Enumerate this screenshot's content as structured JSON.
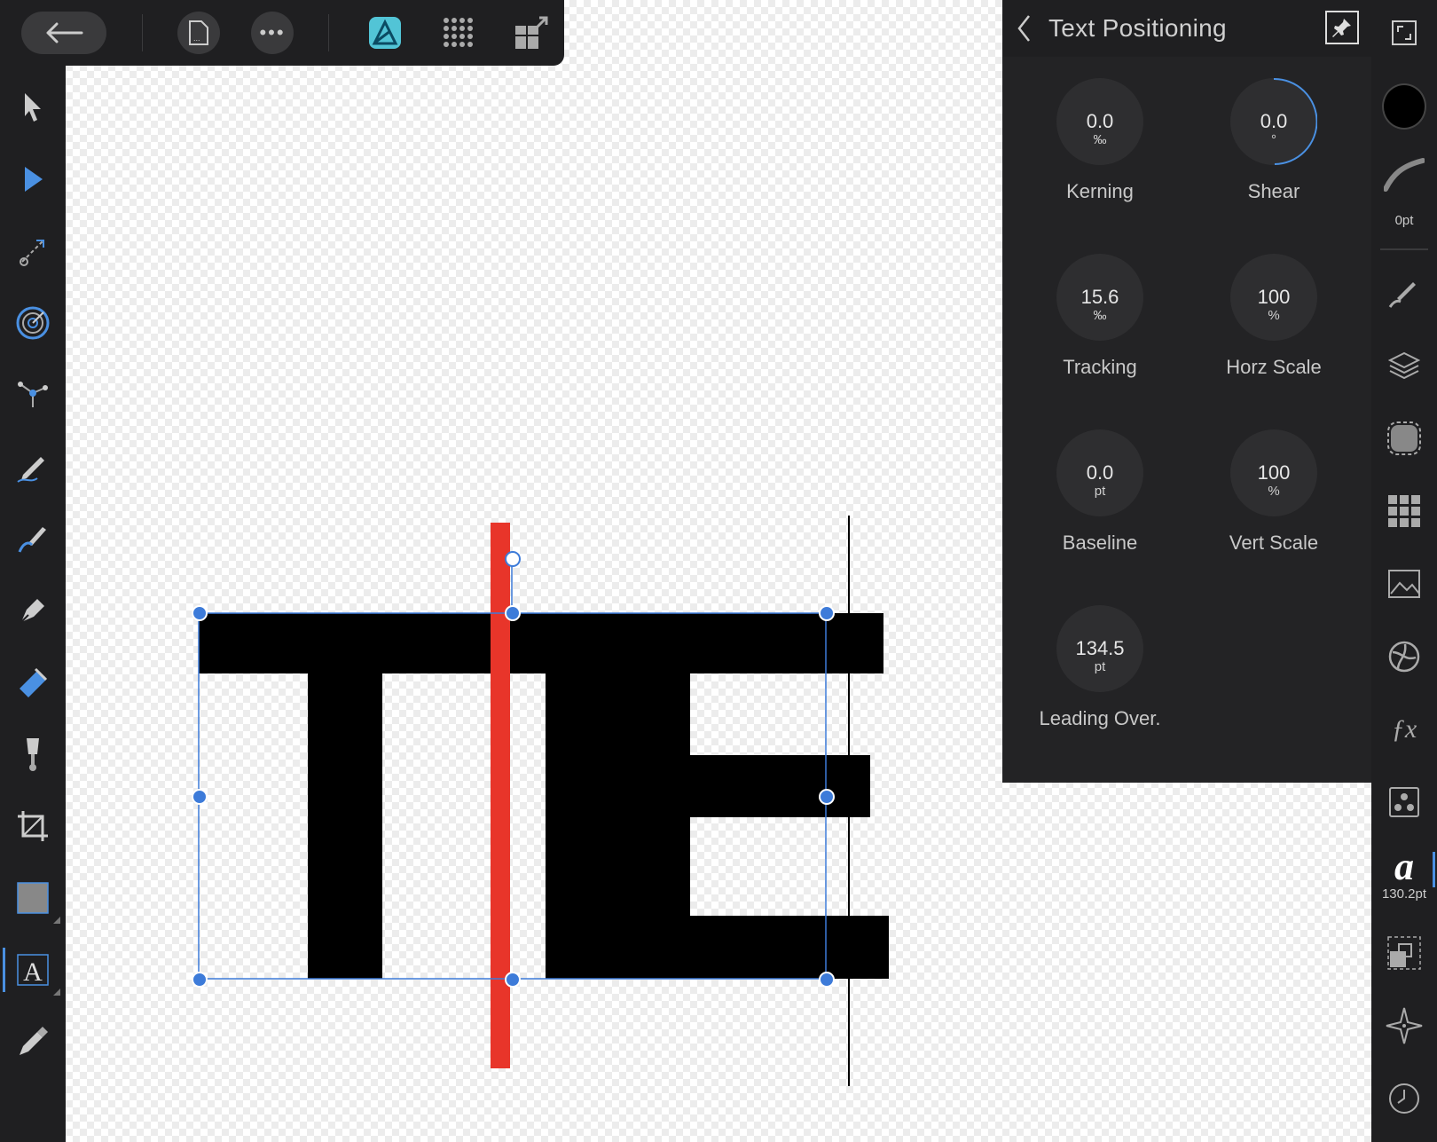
{
  "panel": {
    "title": "Text Positioning",
    "dials": [
      {
        "id": "kerning",
        "value": "0.0",
        "unit": "‰",
        "label": "Kerning"
      },
      {
        "id": "shear",
        "value": "0.0",
        "unit": "°",
        "label": "Shear"
      },
      {
        "id": "tracking",
        "value": "15.6",
        "unit": "‰",
        "label": "Tracking"
      },
      {
        "id": "horz_scale",
        "value": "100",
        "unit": "%",
        "label": "Horz Scale"
      },
      {
        "id": "baseline",
        "value": "0.0",
        "unit": "pt",
        "label": "Baseline"
      },
      {
        "id": "vert_scale",
        "value": "100",
        "unit": "%",
        "label": "Vert Scale"
      },
      {
        "id": "leading",
        "value": "134.5",
        "unit": "pt",
        "label": "Leading Over."
      }
    ]
  },
  "rightbar": {
    "stroke_width": "0pt",
    "font_size": "130.2pt"
  },
  "canvas": {
    "text": "TE"
  },
  "colors": {
    "accent": "#3d7bd9",
    "cursor": "#e8352a",
    "text_fill": "#000000"
  },
  "icons": {
    "top": [
      "back-arrow-icon",
      "document-icon",
      "more-icon",
      "persona-designer-icon",
      "grid-icon",
      "export-icon"
    ],
    "left": [
      "move-tool-icon",
      "node-tool-icon",
      "corner-tool-icon",
      "target-icon",
      "point-transform-icon",
      "pencil-icon",
      "vector-brush-icon",
      "pen-icon",
      "fill-tool-icon",
      "transparency-tool-icon",
      "crop-icon",
      "rectangle-icon",
      "artistic-text-icon",
      "color-picker-icon"
    ],
    "right": [
      "fullscreen-icon",
      "color-swatch-icon",
      "stroke-icon",
      "brush-icon",
      "layers-icon",
      "effects-icon",
      "swatches-grid-icon",
      "image-icon",
      "fx-icon",
      "appearance-icon",
      "character-icon",
      "transform-icon",
      "navigator-icon",
      "history-icon"
    ]
  }
}
